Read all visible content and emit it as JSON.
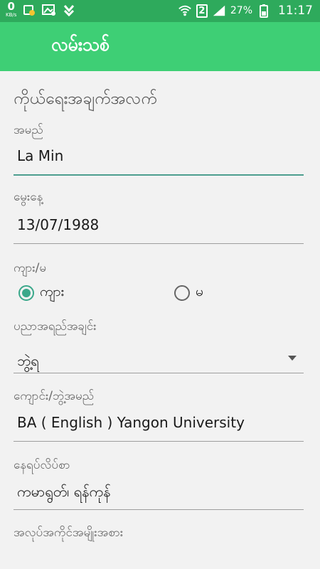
{
  "status_bar": {
    "net_speed_value": "0",
    "net_speed_unit": "KB/s",
    "sim_slot": "2",
    "battery": "27%",
    "time": "11:17",
    "icons": [
      "sync-icon",
      "image-icon",
      "download-check-icon",
      "wifi-icon",
      "signal-icon",
      "battery-icon"
    ]
  },
  "app_bar": {
    "title": "လမ်းသစ်"
  },
  "form": {
    "section_title": "ကိုယ်ရေးအချက်အလက်",
    "name": {
      "label": "အမည်",
      "value": "La Min"
    },
    "dob": {
      "label": "မွေးနေ့",
      "value": "13/07/1988"
    },
    "gender": {
      "label": "ကျား/မ",
      "male": "ကျား",
      "female": "မ",
      "selected": "ကျား"
    },
    "education": {
      "label": "ပညာအရည်အချင်း",
      "value": "ဘွဲ့ရ"
    },
    "school": {
      "label": "ကျောင်း/ဘွဲ့အမည်",
      "value": "BA ( English ) Yangon University"
    },
    "address": {
      "label": "နေရပ်လိပ်စာ",
      "value": "ကမာရွတ်၊ ရန်ကုန်"
    },
    "job_type": {
      "label": "အလုပ်အကိုင်အမျိုးအစား"
    }
  },
  "colors": {
    "status_bar": "#2eaa5c",
    "app_bar": "#3ecf75",
    "accent": "#3aa88a"
  }
}
